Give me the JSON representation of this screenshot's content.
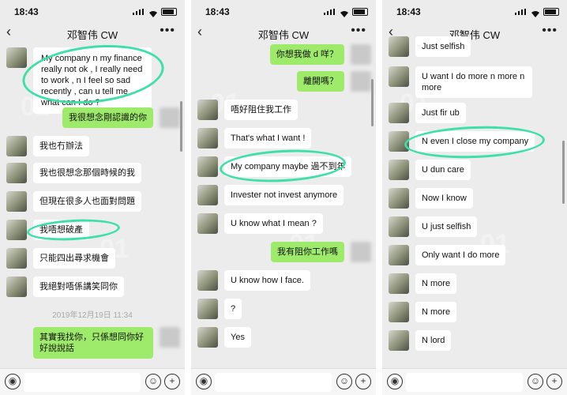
{
  "status": {
    "time": "18:43"
  },
  "contact_name": "邓智伟 CW",
  "nav": {
    "back": "‹",
    "more": "•••"
  },
  "panels": [
    {
      "messages": [
        {
          "side": "left",
          "text": "My company n my finance really not ok , I really need to work , n I feel so sad recently , can u tell me what can I do ?"
        },
        {
          "side": "right",
          "text": "我很想念剛認識的你"
        },
        {
          "side": "left",
          "text": "我也冇辦法"
        },
        {
          "side": "left",
          "text": "我也很想念那個時候的我"
        },
        {
          "side": "left",
          "text": "但現在很多人也面對問題"
        },
        {
          "side": "left",
          "text": "我唔想破產"
        },
        {
          "side": "left",
          "text": "只能四出尋求機會"
        },
        {
          "side": "left",
          "text": "我絕對唔係講笑同你"
        },
        {
          "side": "right",
          "text": "其實我找你，只係想同你好好說說話"
        }
      ],
      "timestamp": "2019年12月19日 11:34"
    },
    {
      "messages": [
        {
          "side": "right",
          "text": "你想我做 d 咩？"
        },
        {
          "side": "right",
          "text": "離開嗎？"
        },
        {
          "side": "left",
          "text": "唔好阻住我工作"
        },
        {
          "side": "left",
          "text": "That's what I want !"
        },
        {
          "side": "left",
          "text": "My company maybe 過不到年"
        },
        {
          "side": "left",
          "text": "Invester not invest anymore"
        },
        {
          "side": "left",
          "text": "U know what I mean ?"
        },
        {
          "side": "right",
          "text": "我有阻你工作嗎"
        },
        {
          "side": "left",
          "text": "U know how I face."
        },
        {
          "side": "left",
          "text": "?"
        },
        {
          "side": "left",
          "text": "Yes"
        }
      ]
    },
    {
      "messages": [
        {
          "side": "left",
          "text": "Just selfish"
        },
        {
          "side": "left",
          "text": "U want I do more n more n more"
        },
        {
          "side": "left",
          "text": "Just fir ub"
        },
        {
          "side": "left",
          "text": "N even I close my company"
        },
        {
          "side": "left",
          "text": "U dun care"
        },
        {
          "side": "left",
          "text": "Now I know"
        },
        {
          "side": "left",
          "text": "U just selfish"
        },
        {
          "side": "left",
          "text": "Only want I do more"
        },
        {
          "side": "left",
          "text": "N more"
        },
        {
          "side": "left",
          "text": "N more"
        },
        {
          "side": "left",
          "text": "N lord"
        }
      ]
    }
  ],
  "watermark": "01",
  "input": {
    "voice_icon": "voice-icon",
    "emoji_icon": "emoji-icon",
    "plus_icon": "plus-icon"
  },
  "highlight_color": "#3ee0a8",
  "bubble_green": "#9eea6a"
}
